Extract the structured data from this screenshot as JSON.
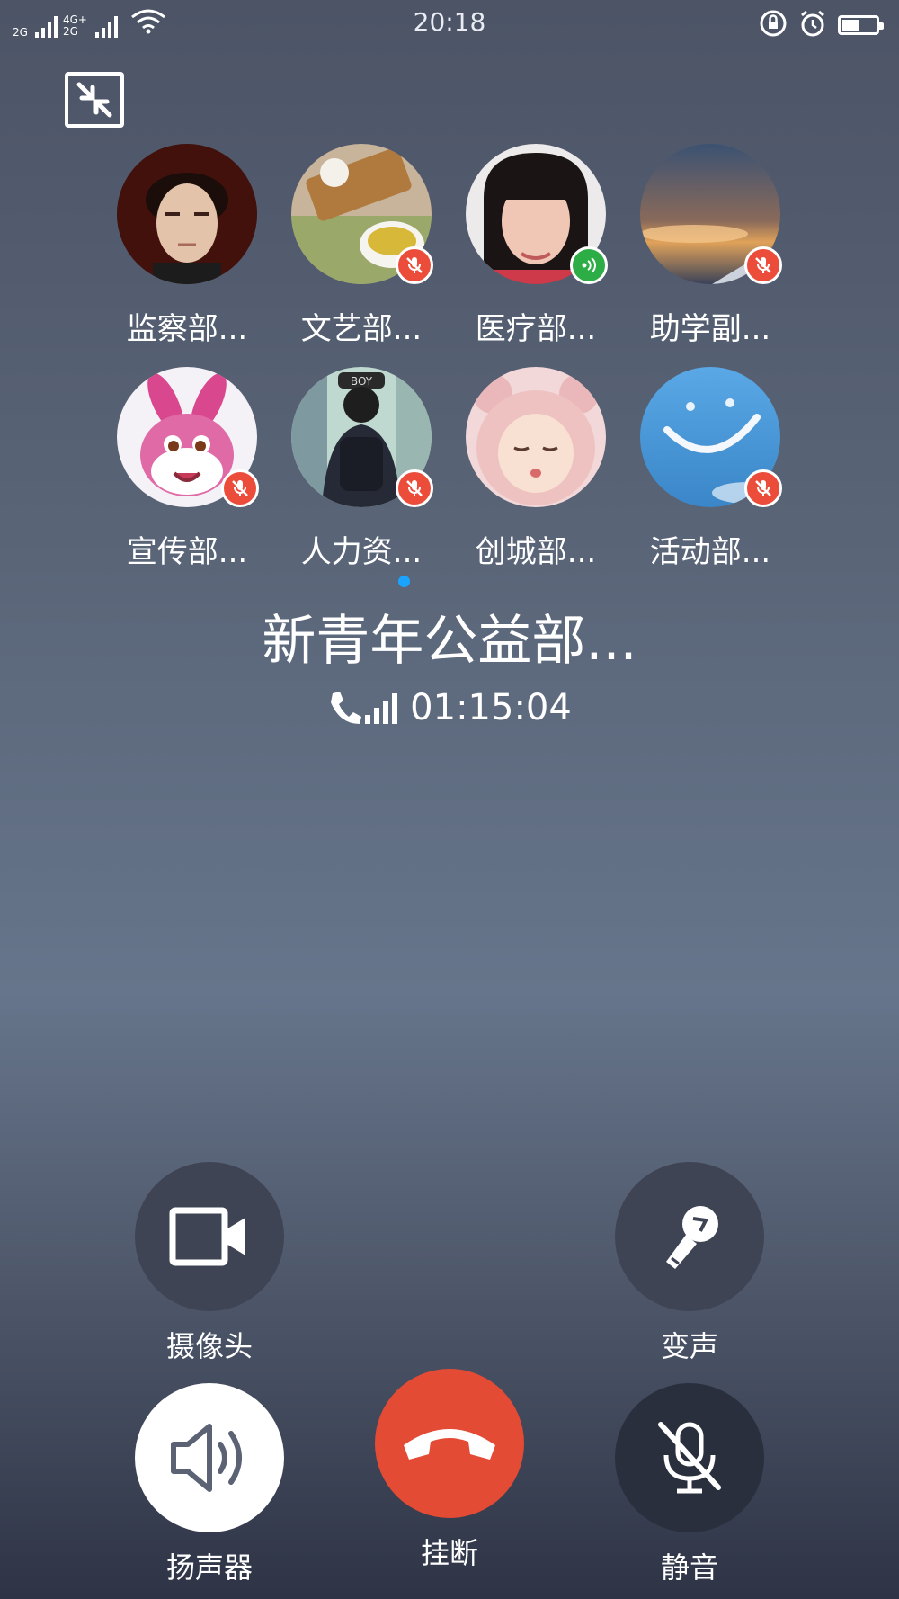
{
  "status_bar": {
    "network_1": "2G",
    "network_2_top": "4G+",
    "network_2_bottom": "2G",
    "time": "20:18"
  },
  "call": {
    "group_name": "新青年公益部...",
    "duration": "01:15:04"
  },
  "members": [
    {
      "name": "监察部...",
      "status": "none"
    },
    {
      "name": "文艺部...",
      "status": "muted"
    },
    {
      "name": "医疗部...",
      "status": "speaking"
    },
    {
      "name": "助学副...",
      "status": "muted"
    },
    {
      "name": "宣传部...",
      "status": "muted"
    },
    {
      "name": "人力资...",
      "status": "muted"
    },
    {
      "name": "创城部...",
      "status": "none"
    },
    {
      "name": "活动部...",
      "status": "muted"
    }
  ],
  "avatar_texts": {
    "boy_cap": "BOY"
  },
  "controls": {
    "camera": "摄像头",
    "voice_change": "变声",
    "speaker": "扬声器",
    "hangup": "挂断",
    "mute": "静音"
  },
  "colors": {
    "hangup": "#e44b34",
    "muted_badge": "#ec4c3a",
    "speaking_badge": "#2dad45",
    "page_indicator": "#1aa3ff"
  }
}
